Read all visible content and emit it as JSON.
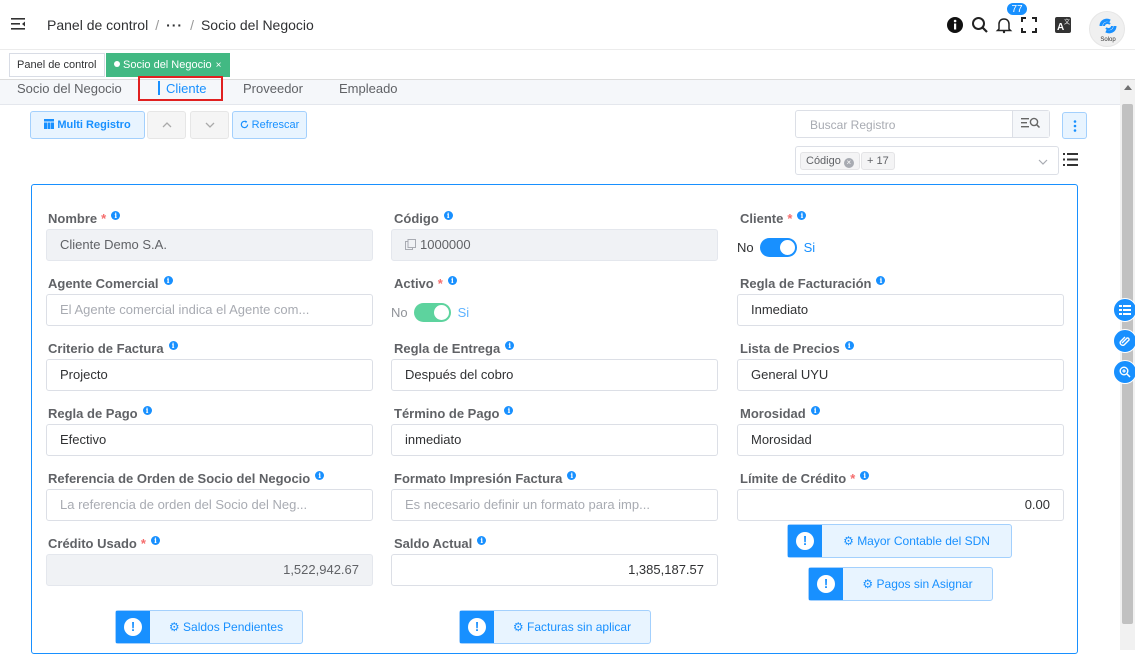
{
  "header": {
    "breadcrumb_root": "Panel de control",
    "breadcrumb_ellipsis": "···",
    "breadcrumb_current": "Socio del Negocio",
    "notification_count": "77",
    "avatar_label": "Solop"
  },
  "tags": {
    "dashboard": "Panel de control",
    "current": "Socio del Negocio",
    "close": "×"
  },
  "tabs": [
    "Socio del Negocio",
    "Cliente",
    "Proveedor",
    "Empleado"
  ],
  "toolbar": {
    "multi_record": "Multi Registro",
    "refresh": "Refrescar",
    "search_placeholder": "Buscar Registro",
    "chip_code": "Código",
    "chip_more": "+ 17"
  },
  "form": {
    "nombre": {
      "label": "Nombre",
      "value": "Cliente Demo S.A."
    },
    "codigo": {
      "label": "Código",
      "value": "1000000"
    },
    "cliente": {
      "label": "Cliente",
      "off": "No",
      "on": "Si"
    },
    "agente": {
      "label": "Agente Comercial",
      "placeholder": "El Agente comercial indica el Agente com..."
    },
    "activo": {
      "label": "Activo",
      "off": "No",
      "on": "Si"
    },
    "regla_facturacion": {
      "label": "Regla de Facturación",
      "value": "Inmediato"
    },
    "criterio_factura": {
      "label": "Criterio de Factura",
      "value": "Projecto"
    },
    "regla_entrega": {
      "label": "Regla de Entrega",
      "value": "Después del cobro"
    },
    "lista_precios": {
      "label": "Lista de Precios",
      "value": "General UYU"
    },
    "regla_pago": {
      "label": "Regla de Pago",
      "value": "Efectivo"
    },
    "termino_pago": {
      "label": "Término de Pago",
      "value": "inmediato"
    },
    "morosidad": {
      "label": "Morosidad",
      "value": "Morosidad"
    },
    "referencia_orden": {
      "label": "Referencia de Orden de Socio del Negocio",
      "placeholder": "La referencia de orden del Socio del Neg..."
    },
    "formato_impresion": {
      "label": "Formato Impresión Factura",
      "placeholder": "Es necesario definir un formato para imp..."
    },
    "limite_credito": {
      "label": "Límite de Crédito",
      "value": "0.00"
    },
    "credito_usado": {
      "label": "Crédito Usado",
      "value": "1,522,942.67"
    },
    "saldo_actual": {
      "label": "Saldo Actual",
      "value": "1,385,187.57"
    }
  },
  "actions": {
    "mayor_contable": "Mayor Contable del SDN",
    "pagos_sin_asignar": "Pagos sin Asignar",
    "saldos_pendientes": "Saldos Pendientes",
    "facturas_sin_aplicar": "Facturas sin aplicar"
  },
  "colors": {
    "primary": "#1890ff",
    "tag_active": "#42b983",
    "switch_active": "#1890ff",
    "switch_active_light": "#5dd39e",
    "required": "#f56c6c"
  }
}
